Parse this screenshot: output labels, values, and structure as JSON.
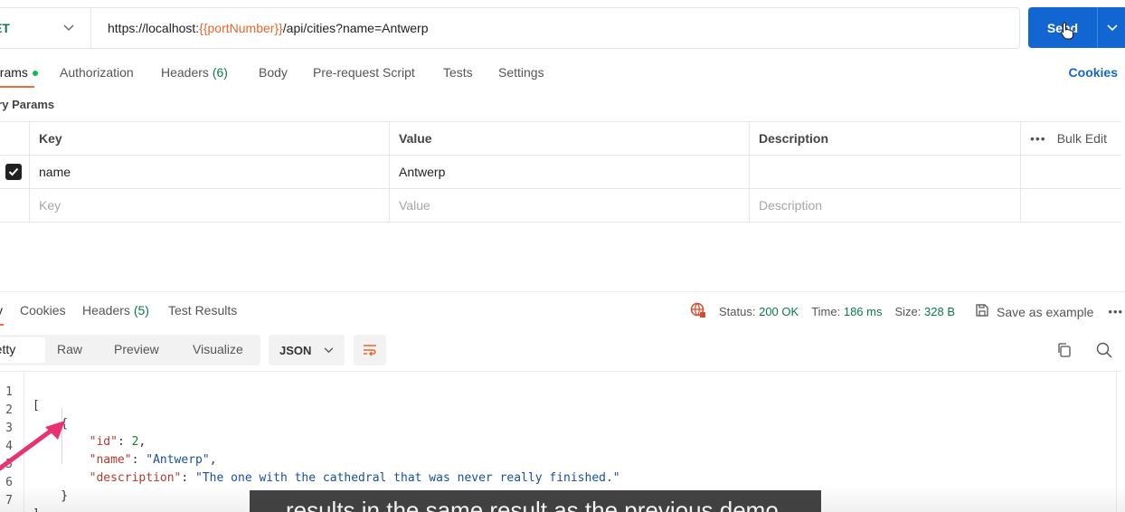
{
  "request": {
    "method": "GET",
    "method_display": "ET",
    "url_prefix": "https://localhost:",
    "url_variable": "{{portNumber}}",
    "url_suffix": "/api/cities?name=Antwerp",
    "send_label": "Send"
  },
  "request_tabs": [
    {
      "label": "arams"
    },
    {
      "label": "Authorization"
    },
    {
      "label": "Headers",
      "count": "(6)"
    },
    {
      "label": "Body"
    },
    {
      "label": "Pre-request Script"
    },
    {
      "label": "Tests"
    },
    {
      "label": "Settings"
    }
  ],
  "cookies_link": "Cookies",
  "query_params": {
    "label": "ery Params",
    "headers": {
      "key": "Key",
      "value": "Value",
      "description": "Description",
      "bulk_edit": "Bulk Edit"
    },
    "rows": [
      {
        "checked": true,
        "key": "name",
        "value": "Antwerp",
        "description": ""
      }
    ],
    "placeholders": {
      "key": "Key",
      "value": "Value",
      "description": "Description"
    }
  },
  "response_tabs": [
    {
      "label": "y"
    },
    {
      "label": "Cookies"
    },
    {
      "label": "Headers",
      "count": "(5)"
    },
    {
      "label": "Test Results"
    }
  ],
  "response_meta": {
    "status_label": "Status:",
    "status_value": "200 OK",
    "time_label": "Time:",
    "time_value": "186 ms",
    "size_label": "Size:",
    "size_value": "328 B",
    "save_example": "Save as example"
  },
  "view_modes": [
    "retty",
    "Raw",
    "Preview",
    "Visualize"
  ],
  "format_select": "JSON",
  "code": {
    "line_numbers": [
      "1",
      "2",
      "3",
      "4",
      "5",
      "6",
      "7"
    ],
    "id_key": "\"id\"",
    "id_value": "2",
    "name_key": "\"name\"",
    "name_value": "\"Antwerp\"",
    "desc_key": "\"description\"",
    "desc_value": "\"The one with the cathedral that was never really finished.\""
  },
  "caption": "results in the same result as the previous demo.",
  "colors": {
    "accent_blue": "#1266d1",
    "method_green": "#0b7a4a",
    "tab_orange": "#f26b3a",
    "arrow_pink": "#e8336f"
  }
}
